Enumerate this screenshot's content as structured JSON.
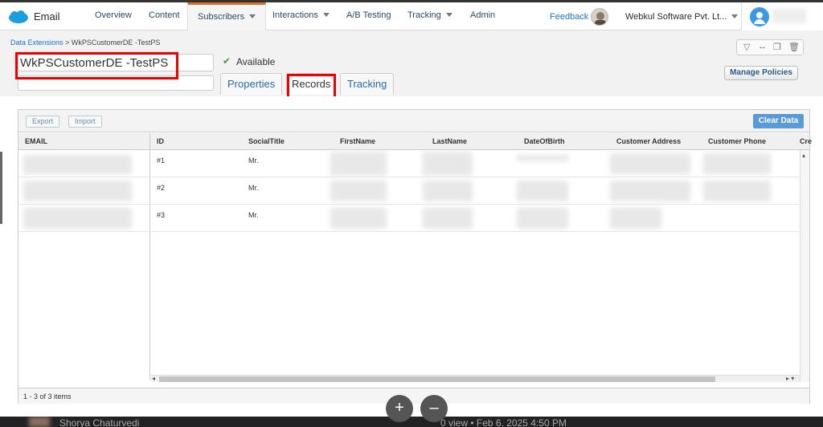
{
  "nav": {
    "app_name": "Email",
    "items": [
      {
        "label": "Overview",
        "dropdown": false
      },
      {
        "label": "Content",
        "dropdown": false
      },
      {
        "label": "Subscribers",
        "dropdown": true,
        "active": true
      },
      {
        "label": "Interactions",
        "dropdown": true
      },
      {
        "label": "A/B Testing",
        "dropdown": false
      },
      {
        "label": "Tracking",
        "dropdown": true
      },
      {
        "label": "Admin",
        "dropdown": false
      }
    ],
    "feedback": "Feedback",
    "org_name": "Webkul Software Pvt. Lt..."
  },
  "breadcrumb": {
    "parent": "Data Extensions",
    "separator": ">",
    "current": "WkPSCustomerDE -TestPS"
  },
  "extension": {
    "name": "WkPSCustomerDE -TestPS",
    "status": "Available"
  },
  "tabs": [
    "Properties",
    "Records",
    "Tracking"
  ],
  "toolbar": {
    "manage_policies": "Manage Policies",
    "export": "Export",
    "import": "Import",
    "clear_data": "Clear Data"
  },
  "table": {
    "columns": [
      "EMAIL",
      "ID",
      "SocialTitle",
      "FirstName",
      "LastName",
      "DateOfBirth",
      "Customer Address",
      "Customer Phone",
      "Cre"
    ],
    "rows": [
      {
        "id": "#1",
        "social_title": "Mr."
      },
      {
        "id": "#2",
        "social_title": "Mr."
      },
      {
        "id": "#3",
        "social_title": "Mr."
      }
    ],
    "items_count": "1 - 3 of 3 items"
  },
  "bottom_bar": {
    "user": "Shorya Chaturvedi",
    "meta": "0 view  •  Feb 6, 2025 4:50 PM"
  },
  "zoom": {
    "in": "+",
    "out": "–"
  }
}
